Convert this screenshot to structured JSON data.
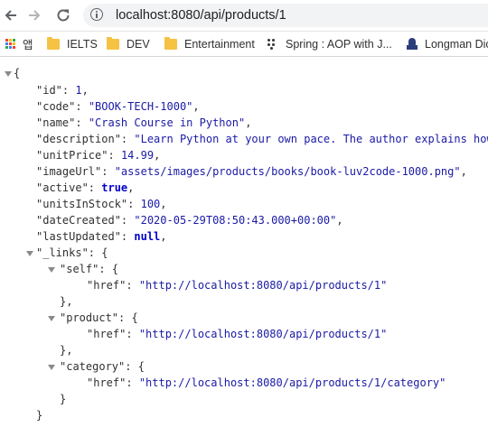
{
  "browser": {
    "url": "localhost:8080/api/products/1"
  },
  "bookmarks": {
    "apps_label": "앱",
    "items": [
      {
        "label": "IELTS",
        "icon": "folder-icon"
      },
      {
        "label": "DEV",
        "icon": "folder-icon"
      },
      {
        "label": "Entertainment",
        "icon": "folder-icon"
      },
      {
        "label": "Spring : AOP with J...",
        "icon": "spring-icon"
      },
      {
        "label": "Longman Dic",
        "icon": "longman-icon"
      }
    ]
  },
  "json": {
    "id": "1",
    "code": "\"BOOK-TECH-1000\"",
    "name": "\"Crash Course in Python\"",
    "description": "\"Learn Python at your own pace. The author explains how t",
    "unitPrice": "14.99",
    "imageUrl": "\"assets/images/products/books/book-luv2code-1000.png\"",
    "active": "true",
    "unitsInStock": "100",
    "dateCreated": "\"2020-05-29T08:50:43.000+00:00\"",
    "lastUpdated": "null",
    "self_href": "\"http://localhost:8080/api/products/1\"",
    "product_href": "\"http://localhost:8080/api/products/1\"",
    "category_href": "\"http://localhost:8080/api/products/1/category\""
  },
  "keys": {
    "id": "\"id\"",
    "code": "\"code\"",
    "name": "\"name\"",
    "description": "\"description\"",
    "unitPrice": "\"unitPrice\"",
    "imageUrl": "\"imageUrl\"",
    "active": "\"active\"",
    "unitsInStock": "\"unitsInStock\"",
    "dateCreated": "\"dateCreated\"",
    "lastUpdated": "\"lastUpdated\"",
    "links": "\"_links\"",
    "self": "\"self\"",
    "product": "\"product\"",
    "category": "\"category\"",
    "href": "\"href\""
  },
  "punct": {
    "open": "{",
    "close": "}",
    "close_comma": "},",
    "colon": ": ",
    "colon_open": ": {",
    "comma": ","
  },
  "colors": {
    "string": "#1a1aa6",
    "number": "#1a1aa6",
    "keyword": "#0000cc",
    "toggle": "#8a8a8a"
  }
}
